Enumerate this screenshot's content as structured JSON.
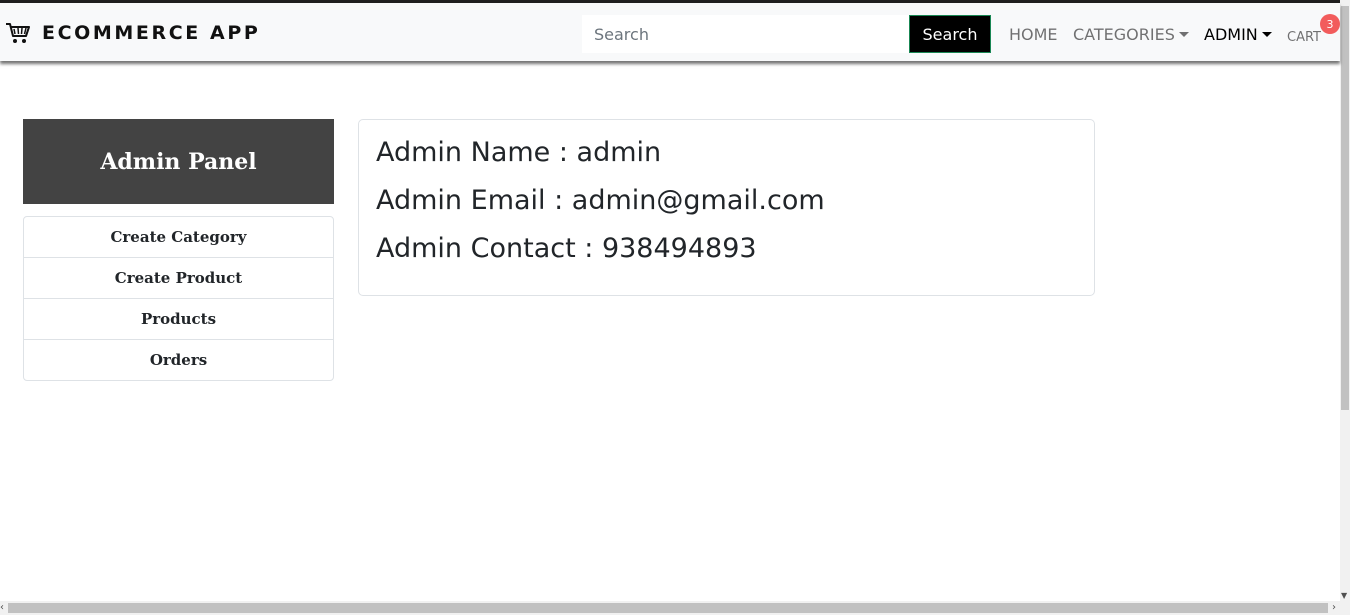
{
  "navbar": {
    "brand_icon": "shopping-cart-icon",
    "brand": "ECOMMERCE APP",
    "search_placeholder": "Search",
    "search_button": "Search",
    "links": {
      "home": "HOME",
      "categories": "CATEGORIES",
      "admin": "ADMIN",
      "cart": "CART"
    },
    "cart_count": "3"
  },
  "sidebar": {
    "title": "Admin Panel",
    "items": [
      {
        "label": "Create Category"
      },
      {
        "label": "Create Product"
      },
      {
        "label": "Products"
      },
      {
        "label": "Orders"
      }
    ]
  },
  "admin_info": {
    "name_line": "Admin Name : admin",
    "email_line": "Admin Email : admin@gmail.com",
    "contact_line": "Admin Contact : 938494893"
  },
  "colors": {
    "panel_header_bg": "#434343",
    "search_button_bg": "#000000",
    "badge_bg": "#f25c5c",
    "navbar_bg": "#f8f9fa"
  }
}
